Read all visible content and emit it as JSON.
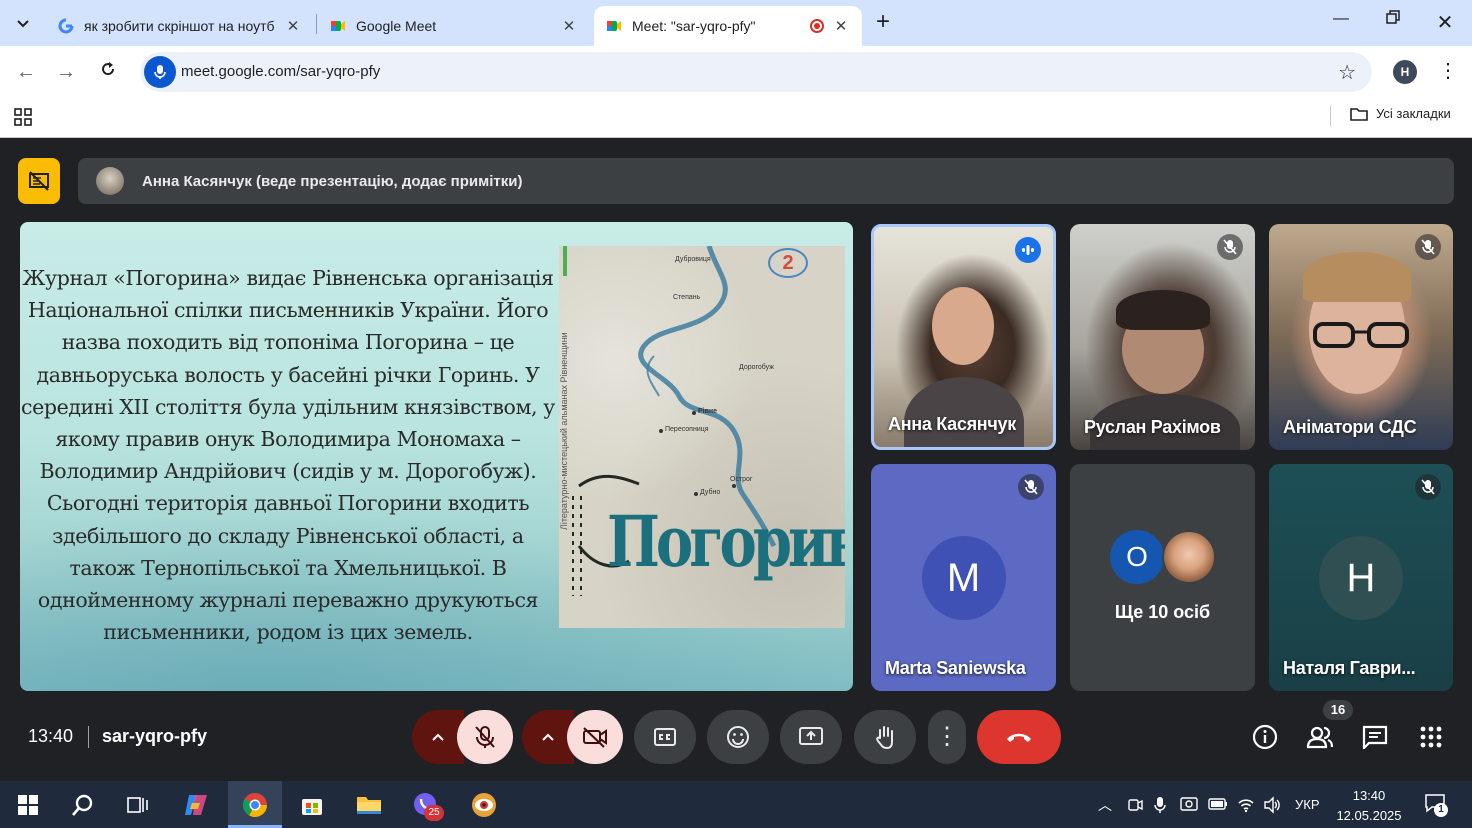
{
  "browser": {
    "tabs": [
      {
        "title": "як зробити скріншот на ноутб",
        "favicon": "google-g-icon"
      },
      {
        "title": "Google Meet",
        "favicon": "meet-icon"
      },
      {
        "title": "Meet: \"sar-yqro-pfy\"",
        "favicon": "meet-icon",
        "recording": true
      }
    ],
    "url": "meet.google.com/sar-yqro-pfy",
    "profile_initial": "H",
    "bookmarks_label": "Усі закладки"
  },
  "presentation": {
    "banner": "Анна Касянчук (веде презентацію, додає примітки)",
    "slide_text": "Журнал «Погорина» видає Рівненська організація Національної спілки письменників України. Його назва походить від топоніма Погорина – це давньоруська волость у басейні річки Горинь. У середині XII століття була удільним князівством, у якому правив онук Володимира Мономаха – Володимир Андрійович (сидів у м. Дорогобуж). Сьогодні територія давньої Погорини входить здебільшого до складу Рівненської області, а також Тернопільської та Хмельницької. В однойменному журналі переважно друкуються письменники, родом із цих земель.",
    "magazine": {
      "number": "2",
      "title": "Погорина",
      "side_text": "Літературно-мистецький альманах Рівненщини",
      "cities": [
        "Дубровиця",
        "Степань",
        "Дорогобуж",
        "Рівне",
        "Пересопниця",
        "Острог",
        "Дубно"
      ]
    }
  },
  "participants": [
    {
      "name": "Анна Касянчук",
      "speaking": true,
      "video": true
    },
    {
      "name": "Руслан Рахімов",
      "muted": true,
      "video": true
    },
    {
      "name": "Аніматори СДС",
      "muted": true,
      "video": true
    },
    {
      "name": "Marta Saniewska",
      "muted": true,
      "initial": "M",
      "avatar_color": "#3f51b5"
    },
    {
      "name": "Наталя Гаври...",
      "muted": true,
      "initial": "Н",
      "avatar_color": "#2f4f52"
    }
  ],
  "more": {
    "initial": "О",
    "label": "Ще 10 осіб",
    "avatar_color": "#1557b0"
  },
  "controls": {
    "time": "13:40",
    "meeting_code": "sar-yqro-pfy",
    "people_count": "16"
  },
  "taskbar": {
    "meet_badge": "25",
    "language": "УКР",
    "time": "13:40",
    "date": "12.05.2025",
    "notifications": "1"
  }
}
